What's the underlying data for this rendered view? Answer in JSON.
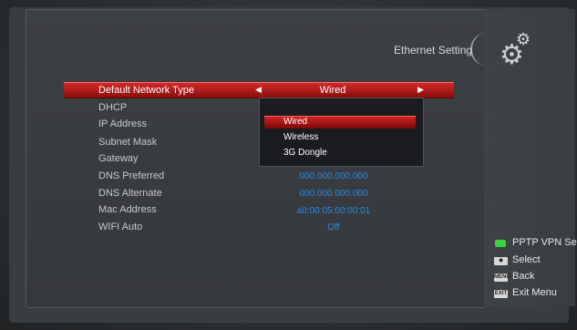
{
  "header": {
    "title": "Ethernet Setting",
    "icon": "gears-icon"
  },
  "settings": {
    "selected": {
      "label": "Default Network Type",
      "value": "Wired"
    },
    "rows": [
      {
        "label": "DHCP",
        "value": ""
      },
      {
        "label": "IP Address",
        "value": ""
      },
      {
        "label": "Subnet Mask",
        "value": ""
      },
      {
        "label": "Gateway",
        "value": ""
      },
      {
        "label": "DNS Preferred",
        "value": "000.000.000.000"
      },
      {
        "label": "DNS Alternate",
        "value": "000.000.000.000"
      },
      {
        "label": "Mac Address",
        "value": "a0:00:05:00:00:01"
      },
      {
        "label": "WIFI Auto",
        "value": "Off"
      }
    ]
  },
  "dropdown": {
    "options": [
      "Wired",
      "Wireless",
      "3G Dongle"
    ],
    "selected_index": 0
  },
  "legend": {
    "green": {
      "label": "PPTP VPN Setti",
      "color": "#3ecf3e"
    },
    "select": {
      "key": "◆",
      "label": "Select"
    },
    "back": {
      "key": "MENU",
      "label": "Back"
    },
    "exit": {
      "key": "EXIT",
      "label": "Exit Menu"
    }
  },
  "colors": {
    "highlight": "#c81e1e",
    "value_text": "#2a8ae0"
  }
}
